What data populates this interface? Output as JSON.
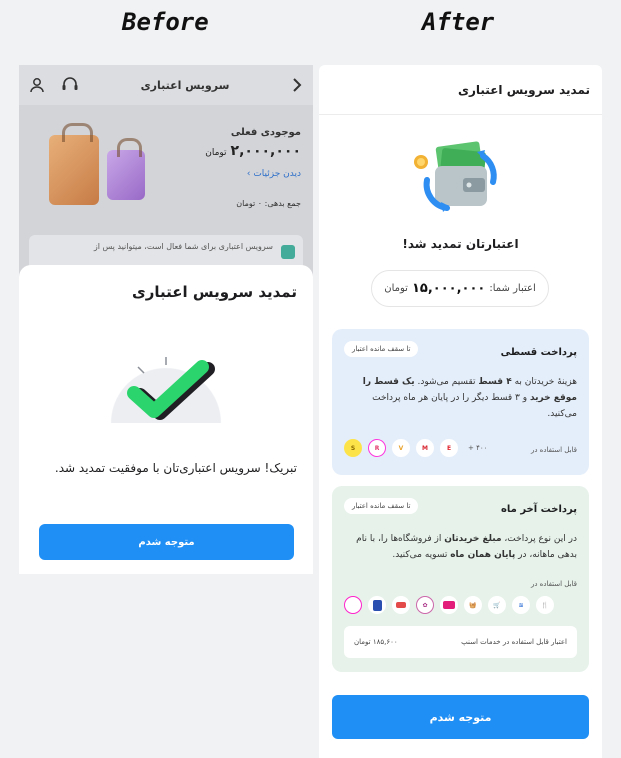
{
  "labels": {
    "before": "Before",
    "after": "After"
  },
  "before": {
    "header_title": "سرویس اعتباری",
    "balance_label": "موجودی فعلی",
    "balance_value": "۲,۰۰۰,۰۰۰",
    "balance_unit": "تومان",
    "details_link": "دیدن جزئیات",
    "debt_text": "جمع بدهی: ۰ تومان",
    "info_text": "سرویس اعتباری برای شما فعال است، میتوانید پس از",
    "sheet_title": "تمدید سرویس اعتباری",
    "message": "تبریک! سرویس اعتباری‌تان با موفقیت تمدید شد.",
    "button_label": "متوجه شدم"
  },
  "after": {
    "header_title": "تمدید سرویس اعتباری",
    "success_text": "اعتبارتان تمدید شد!",
    "credit_label": "اعتبار شما:",
    "credit_value": "۱۵,۰۰۰,۰۰۰",
    "credit_unit": "تومان",
    "installment": {
      "title": "پرداخت قسطی",
      "chip": "تا سقف مانده اعتبار",
      "desc_1": "هزینهٔ خریدتان به ",
      "desc_b1": "۴ قسط",
      "desc_2": " تقسیم می‌شود. ",
      "desc_b2": "یک قسط را موقع خرید",
      "desc_3": " و ۳ قسط دیگر را در پایان هر ماه پرداخت می‌کنید.",
      "usable_label": "قابل استفاده در",
      "more_count": "+ ۴۰۰",
      "logos": [
        "E",
        "M",
        "V",
        "R",
        "S"
      ]
    },
    "month_end": {
      "title": "پرداخت آخر ماه",
      "chip": "تا سقف مانده اعتبار",
      "desc_1": "در این نوع پرداخت، ",
      "desc_b1": "مبلغ خریدتان",
      "desc_2": " از فروشگاه‌ها را، با نام بدهی ماهانه، در ",
      "desc_b2": "پایان همان ماه",
      "desc_3": " تسویه می‌کنید.",
      "usable_label": "قابل استفاده در",
      "snapp_label": "اعتبار قابل استفاده در خدمات اسنپ",
      "snapp_value": "۱۸۵,۶۰۰ تومان"
    },
    "button_label": "متوجه شدم"
  }
}
